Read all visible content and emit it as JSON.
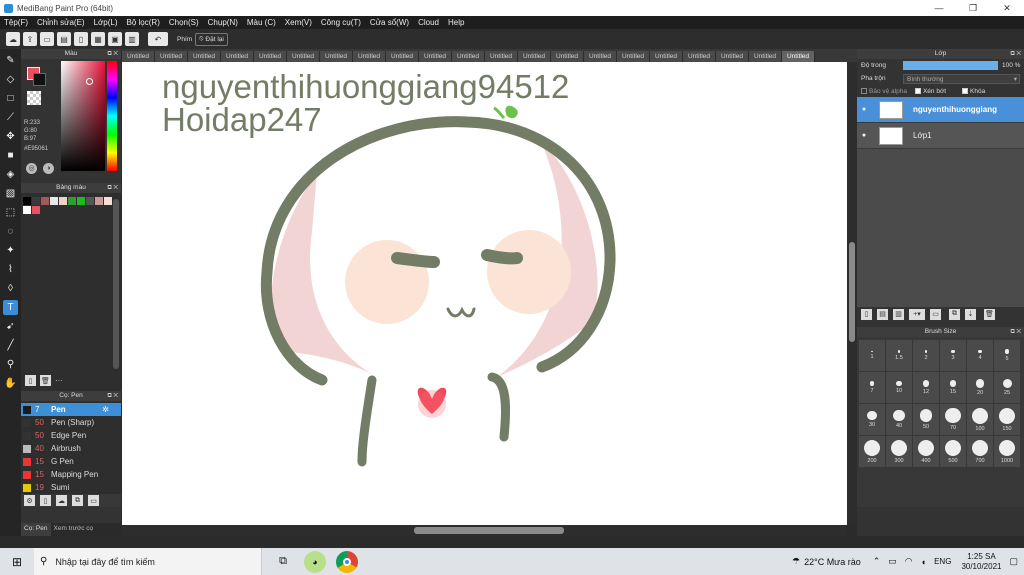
{
  "window": {
    "title": "MediBang Paint Pro (64bit)"
  },
  "menu": [
    "Tệp(F)",
    "Chỉnh sửa(E)",
    "Lớp(L)",
    "Bộ lọc(R)",
    "Chọn(S)",
    "Chụp(N)",
    "Màu (C)",
    "Xem(V)",
    "Công cụ(T)",
    "Cửa sổ(W)",
    "Cloud",
    "Help"
  ],
  "toolbar": {
    "key_label": "Phím",
    "reset_label": "Đặt lại"
  },
  "tabs": [
    "Untitled",
    "Untitled",
    "Untitled",
    "Untitled",
    "Untitled",
    "Untitled",
    "Untitled",
    "Untitled",
    "Untitled",
    "Untitled",
    "Untitled",
    "Untitled",
    "Untitled",
    "Untitled",
    "Untitled",
    "Untitled",
    "Untitled",
    "Untitled",
    "Untitled",
    "Untitled",
    "Untitled"
  ],
  "color_panel": {
    "title": "Màu",
    "r": "R:233",
    "g": "G:80",
    "b": "B:97",
    "hex": "#E95061",
    "fg_color": "#e95061"
  },
  "palette": {
    "title": "Bảng màu",
    "swatches": [
      "#000000",
      "#3a3a3a",
      "#a05a5a",
      "#e8e8e8",
      "#f0d2c6",
      "#2e9f2e",
      "#1dbb1d",
      "#555555",
      "#c99",
      "#f3ded8",
      "#ffffff"
    ],
    "extra": "#e95061",
    "more": "···"
  },
  "brush_list": {
    "title": "Cọ: Pen",
    "items": [
      {
        "size": "7",
        "name": "Pen",
        "color": "#1b1b1b",
        "selected": true
      },
      {
        "size": "50",
        "name": "Pen (Sharp)",
        "color": "#333"
      },
      {
        "size": "50",
        "name": "Edge Pen",
        "color": "#333"
      },
      {
        "size": "40",
        "name": "Airbrush",
        "color": "#bbb"
      },
      {
        "size": "15",
        "name": "G Pen",
        "color": "#e33"
      },
      {
        "size": "15",
        "name": "Mapping Pen",
        "color": "#e33"
      },
      {
        "size": "19",
        "name": "Sumi",
        "color": "#e5c900"
      }
    ],
    "tab1": "Cọ: Pen",
    "tab2": "Xem trước cọ"
  },
  "canvas": {
    "text_line1": "nguyenthihuonggiang94512",
    "text_line2": "Hoidap247"
  },
  "layers": {
    "title": "Lớp",
    "opacity_label": "Độ trong",
    "opacity_value": "100 %",
    "blend_label": "Pha trộn",
    "blend_value": "Bình thường",
    "alpha_label": "Bảo vệ alpha",
    "clip_label": "Xén bớt",
    "lock_label": "Khóa",
    "items": [
      {
        "name": "nguyenthihuonggiang",
        "selected": true
      },
      {
        "name": "Lớp1",
        "selected": false
      }
    ]
  },
  "brush_size": {
    "title": "Brush Size",
    "sizes": [
      "1",
      "1.5",
      "2",
      "3",
      "4",
      "5",
      "7",
      "10",
      "12",
      "15",
      "20",
      "25",
      "30",
      "40",
      "50",
      "70",
      "100",
      "150",
      "200",
      "300",
      "400",
      "500",
      "700",
      "1000"
    ]
  },
  "taskbar": {
    "search_placeholder": "Nhập tại đây để tìm kiếm",
    "weather": "22°C  Mưa rào",
    "lang": "ENG",
    "time": "1:25 SA",
    "date": "30/10/2021"
  }
}
